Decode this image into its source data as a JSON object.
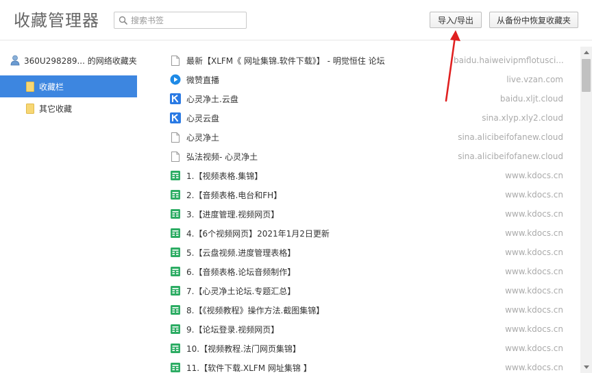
{
  "header": {
    "title": "收藏管理器",
    "search_placeholder": "搜索书签",
    "import_export_label": "导入/导出",
    "restore_label": "从备份中恢复收藏夹"
  },
  "sidebar": {
    "account": "360U298289... 的网络收藏夹",
    "folders": [
      {
        "label": "收藏栏",
        "active": true
      },
      {
        "label": "其它收藏",
        "active": false
      }
    ]
  },
  "colors": {
    "accent": "#3d86e0",
    "folder_icon": "#f7d774",
    "kdocs_green": "#2cac63",
    "k_blue": "#2a7ae4",
    "annotation_red": "#e02020"
  },
  "bookmarks": [
    {
      "icon": "page-icon",
      "name": "最新【XLFM《 网址集锦.软件下载》】 - 明觉恒住 论坛",
      "url": "baidu.haiweivipmflotusci..."
    },
    {
      "icon": "vzan-icon",
      "name": "微赞直播",
      "url": "live.vzan.com"
    },
    {
      "icon": "k-icon",
      "name": "心灵净土.云盘",
      "url": "baidu.xljt.cloud"
    },
    {
      "icon": "k-icon",
      "name": "心灵云盘",
      "url": "sina.xlyp.xly2.cloud"
    },
    {
      "icon": "page-icon",
      "name": "心灵净土",
      "url": "sina.alicibeifofanew.cloud"
    },
    {
      "icon": "page-icon",
      "name": "弘法视频- 心灵净土",
      "url": "sina.alicibeifofanew.cloud"
    },
    {
      "icon": "kdocs-icon",
      "name": "1.【视频表格.集锦】",
      "url": "www.kdocs.cn"
    },
    {
      "icon": "kdocs-icon",
      "name": "2.【音频表格.电台和FH】",
      "url": "www.kdocs.cn"
    },
    {
      "icon": "kdocs-icon",
      "name": "3.【进度管理.视频网页】",
      "url": "www.kdocs.cn"
    },
    {
      "icon": "kdocs-icon",
      "name": "4.【6个视频网页】2021年1月2日更新",
      "url": "www.kdocs.cn"
    },
    {
      "icon": "kdocs-icon",
      "name": "5.【云盘视频.进度管理表格】",
      "url": "www.kdocs.cn"
    },
    {
      "icon": "kdocs-icon",
      "name": "6.【音频表格.论坛音频制作】",
      "url": "www.kdocs.cn"
    },
    {
      "icon": "kdocs-icon",
      "name": "7.【心灵净土论坛.专题汇总】",
      "url": "www.kdocs.cn"
    },
    {
      "icon": "kdocs-icon",
      "name": "8.【《视频教程》操作方法.截图集锦】",
      "url": "www.kdocs.cn"
    },
    {
      "icon": "kdocs-icon",
      "name": "9.【论坛登录.视频网页】",
      "url": "www.kdocs.cn"
    },
    {
      "icon": "kdocs-icon",
      "name": "10.【视频教程.法门网页集锦】",
      "url": "www.kdocs.cn"
    },
    {
      "icon": "kdocs-icon",
      "name": "11.【软件下载.XLFM 网址集锦 】",
      "url": "www.kdocs.cn"
    }
  ]
}
